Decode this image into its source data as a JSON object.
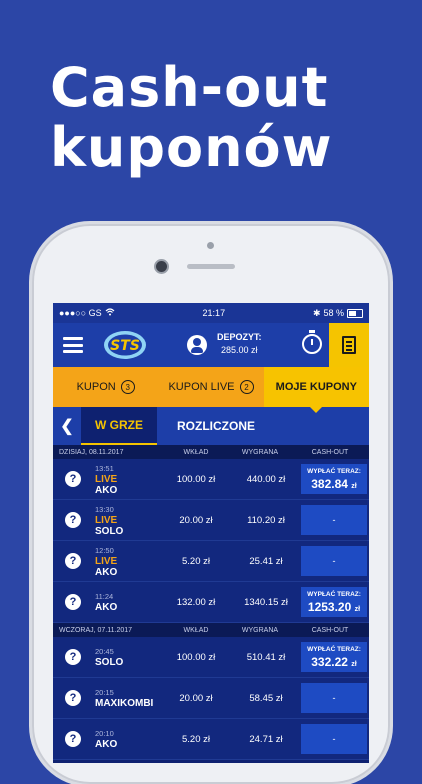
{
  "headline": {
    "line1": "Cash-out",
    "line2": "kuponów"
  },
  "statusbar": {
    "carrier": "●●●○○ GS",
    "wifi": "wifi-icon",
    "time": "21:17",
    "bluetooth": "✱",
    "battery": "58 %"
  },
  "appbar": {
    "deposit_label": "DEPOZYT:",
    "deposit_value": "285.00 zł"
  },
  "tabs": [
    {
      "label": "KUPON",
      "count": "3"
    },
    {
      "label": "KUPON LIVE",
      "count": "2"
    },
    {
      "label": "MOJE KUPONY"
    }
  ],
  "subtabs": {
    "active": "W GRZE",
    "other": "ROZLICZONE"
  },
  "sections": [
    {
      "date": "DZISIAJ, 08.11.2017",
      "col_stake": "WKŁAD",
      "col_win": "WYGRANA",
      "col_cashout": "CASH-OUT",
      "rows": [
        {
          "time": "13:51",
          "live": "LIVE",
          "type": "AKO",
          "stake": "100.00 zł",
          "win": "440.00 zł",
          "co_label": "WYPŁAĆ TERAZ:",
          "co_amount": "382.84",
          "co_unit": "zł",
          "dash": ""
        },
        {
          "time": "13:30",
          "live": "LIVE",
          "type": "SOLO",
          "stake": "20.00 zł",
          "win": "110.20 zł",
          "co_label": "",
          "co_amount": "",
          "co_unit": "",
          "dash": "-"
        },
        {
          "time": "12:50",
          "live": "LIVE",
          "type": "AKO",
          "stake": "5.20 zł",
          "win": "25.41 zł",
          "co_label": "",
          "co_amount": "",
          "co_unit": "",
          "dash": "-"
        },
        {
          "time": "11:24",
          "live": "",
          "type": "AKO",
          "stake": "132.00 zł",
          "win": "1340.15 zł",
          "co_label": "WYPŁAĆ TERAZ:",
          "co_amount": "1253.20",
          "co_unit": "zł",
          "dash": ""
        }
      ]
    },
    {
      "date": "WCZORAJ, 07.11.2017",
      "col_stake": "WKŁAD",
      "col_win": "WYGRANA",
      "col_cashout": "CASH-OUT",
      "rows": [
        {
          "time": "20:45",
          "live": "",
          "type": "SOLO",
          "stake": "100.00 zł",
          "win": "510.41 zł",
          "co_label": "WYPŁAĆ TERAZ:",
          "co_amount": "332.22",
          "co_unit": "zł",
          "dash": ""
        },
        {
          "time": "20:15",
          "live": "",
          "type": "MAXIKOMBI",
          "stake": "20.00 zł",
          "win": "58.45 zł",
          "co_label": "",
          "co_amount": "",
          "co_unit": "",
          "dash": "-"
        },
        {
          "time": "20:10",
          "live": "",
          "type": "AKO",
          "stake": "5.20 zł",
          "win": "24.71 zł",
          "co_label": "",
          "co_amount": "",
          "co_unit": "",
          "dash": "-"
        }
      ]
    }
  ],
  "colors": {
    "background": "#2c46a6",
    "accent": "#f5c400",
    "tab_orange": "#f4a418",
    "live": "#f4a418"
  }
}
